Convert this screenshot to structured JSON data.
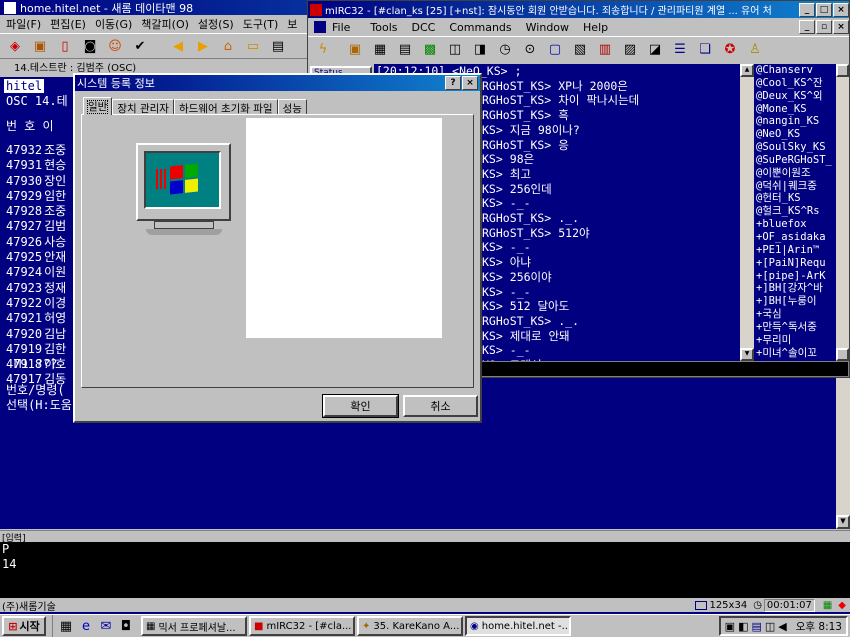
{
  "hitel": {
    "title": "home.hitel.net - 새롬 데이타맨 98",
    "menu": [
      "파일(F)",
      "편집(E)",
      "이동(G)",
      "책갈피(O)",
      "설정(S)",
      "도구(T)",
      "보"
    ],
    "bar_text": "14.테스트란 : 김범주 (OSC)",
    "header": "hitel",
    "line2": "OSC 14.테",
    "col_header": "번 호  이",
    "rows": [
      {
        "num": "47932",
        "name": "조중"
      },
      {
        "num": "47931",
        "name": "현승"
      },
      {
        "num": "47930",
        "name": "장인"
      },
      {
        "num": "47929",
        "name": "임한"
      },
      {
        "num": "47928",
        "name": "조중"
      },
      {
        "num": "47927",
        "name": "김범"
      },
      {
        "num": "47926",
        "name": "사승"
      },
      {
        "num": "47925",
        "name": "안재"
      },
      {
        "num": "47924",
        "name": "이원"
      },
      {
        "num": "47923",
        "name": "정재"
      },
      {
        "num": "47922",
        "name": "이경"
      },
      {
        "num": "47921",
        "name": "허영"
      },
      {
        "num": "47920",
        "name": "김남"
      },
      {
        "num": "47919",
        "name": "김한"
      },
      {
        "num": "47918",
        "name": "이호"
      },
      {
        "num": "47917",
        "name": "김동"
      }
    ],
    "m1": "M1 ???",
    "cmd1": "번호/명령(",
    "cmd2": "선택(H:도움",
    "input_label": "[입력]",
    "input_lines": [
      "P",
      "14"
    ],
    "status_left": "(주)새롬기술",
    "status_size": "125x34",
    "status_time": "00:01:07"
  },
  "mirc": {
    "title": "mIRC32 - [#clan_ks [25] [+nst]: 잠시동안 회원 안받습니다. 죄송합니다 / 관리파티원 계열 ... 유어 처",
    "menu": [
      "File",
      "Tools",
      "DCC",
      "Commands",
      "Window",
      "Help"
    ],
    "status_tab": "Status",
    "chat": [
      {
        "n": "[20:12:10] <NeO_KS>",
        "t": ";"
      },
      {
        "n": "RGHoST_KS>",
        "t": "XP나 2000은"
      },
      {
        "n": "RGHoST_KS>",
        "t": "차이 팍나시는데"
      },
      {
        "n": "RGHoST_KS>",
        "t": "흑"
      },
      {
        "n": "KS>",
        "t": "지금 98이나?"
      },
      {
        "n": "RGHoST_KS>",
        "t": "응"
      },
      {
        "n": "KS>",
        "t": "98은"
      },
      {
        "n": "KS>",
        "t": "최고"
      },
      {
        "n": "KS>",
        "t": "256인데"
      },
      {
        "n": "KS>",
        "t": "-_-"
      },
      {
        "n": "RGHoST_KS>",
        "t": "._."
      },
      {
        "n": "RGHoST_KS>",
        "t": "512야"
      },
      {
        "n": "KS>",
        "t": "-_-"
      },
      {
        "n": "KS>",
        "t": "아냐"
      },
      {
        "n": "KS>",
        "t": "256이야"
      },
      {
        "n": "KS>",
        "t": "-_-"
      },
      {
        "n": "KS>",
        "t": "512 달아도"
      },
      {
        "n": "RGHoST_KS>",
        "t": "._."
      },
      {
        "n": "KS>",
        "t": "제대로 안돼"
      },
      {
        "n": "KS>",
        "t": "-_-"
      },
      {
        "n": "KS>",
        "t": "그래서"
      }
    ],
    "nicks": [
      "@Chanserv",
      "@Cool_KS^잔",
      "@Deux_KS^외",
      "@Mone_KS",
      "@nangin_KS",
      "@NeO_KS",
      "@SoulSky_KS",
      "@SuPeRGHoST_",
      "@이뿐이원조",
      "@덕쉬|퀘크중",
      "@헌터_KS",
      "@헐크_KS^Rs",
      "+bluefox",
      "+OF_asidaka",
      "+PE1|Arin™",
      "+[PaiN]Requ",
      "+[pipe]-ArK",
      "+]BH[강자^바",
      "+]BH[누룽이",
      "+국심",
      "+만득^독서중",
      "+무리미",
      "+미녀^솔이꼬"
    ]
  },
  "dialog": {
    "title": "시스템 등록 정보",
    "help": "?",
    "close": "×",
    "tabs": [
      "일반",
      "장치 관리자",
      "하드웨어 초기화 파일",
      "성능"
    ],
    "ok": "확인",
    "cancel": "취소"
  },
  "taskbar": {
    "start": "시작",
    "items": [
      "믹서 프로페셔날...",
      "mIRC32 - [#cla...",
      "35. KareKano A...",
      "home.hitel.net -..."
    ],
    "clock": "오후 8:13"
  },
  "colors": {
    "desktop": "#000080",
    "face": "#c0c0c0",
    "title": "#000080"
  }
}
